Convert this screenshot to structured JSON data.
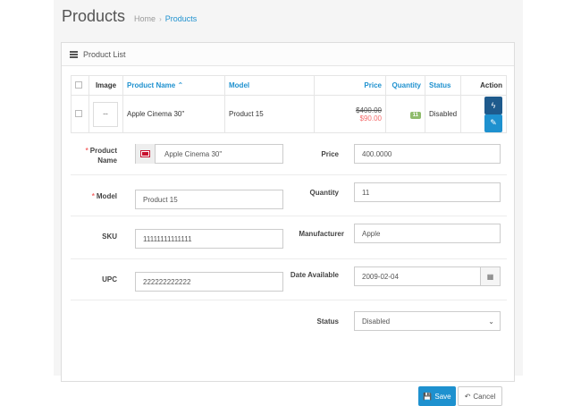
{
  "page": {
    "title": "Products"
  },
  "breadcrumb": {
    "home": "Home",
    "separator": "›",
    "current": "Products"
  },
  "panel": {
    "title": "Product List"
  },
  "table": {
    "headers": {
      "image": "Image",
      "name": "Product Name",
      "sort_icon": "⌃",
      "model": "Model",
      "price": "Price",
      "quantity": "Quantity",
      "status": "Status",
      "action": "Action"
    },
    "rows": [
      {
        "thumb_text": "▪▪▪",
        "name": "Apple Cinema 30\"",
        "model": "Product 15",
        "price_old": "$400.00",
        "price_new": "$90.00",
        "quantity": "11",
        "status": "Disabled"
      }
    ]
  },
  "form": {
    "product_name": {
      "label": "Product Name",
      "value": "Apple Cinema 30\""
    },
    "price": {
      "label": "Price",
      "value": "400.0000"
    },
    "model": {
      "label": "Model",
      "value": "Product 15"
    },
    "quantity": {
      "label": "Quantity",
      "value": "11"
    },
    "sku": {
      "label": "SKU",
      "value": "11111111111111"
    },
    "manufacturer": {
      "label": "Manufacturer",
      "value": "Apple"
    },
    "upc": {
      "label": "UPC",
      "value": "222222222222"
    },
    "date_available": {
      "label": "Date Available",
      "value": "2009-02-04"
    },
    "status": {
      "label": "Status",
      "value": "Disabled"
    },
    "required_mark": "*",
    "save_label": "Save",
    "cancel_label": "Cancel"
  },
  "icons": {
    "filter": "filter-bolt-icon",
    "edit": "pencil-icon",
    "calendar": "calendar-icon",
    "save": "floppy-icon",
    "cancel": "undo-arrow-icon",
    "flag": "uk-flag-icon"
  },
  "colors": {
    "accent": "#1e91cf",
    "dark_button": "#1e5a8c",
    "required": "#f56b6b",
    "badge": "#8fbb6c"
  }
}
